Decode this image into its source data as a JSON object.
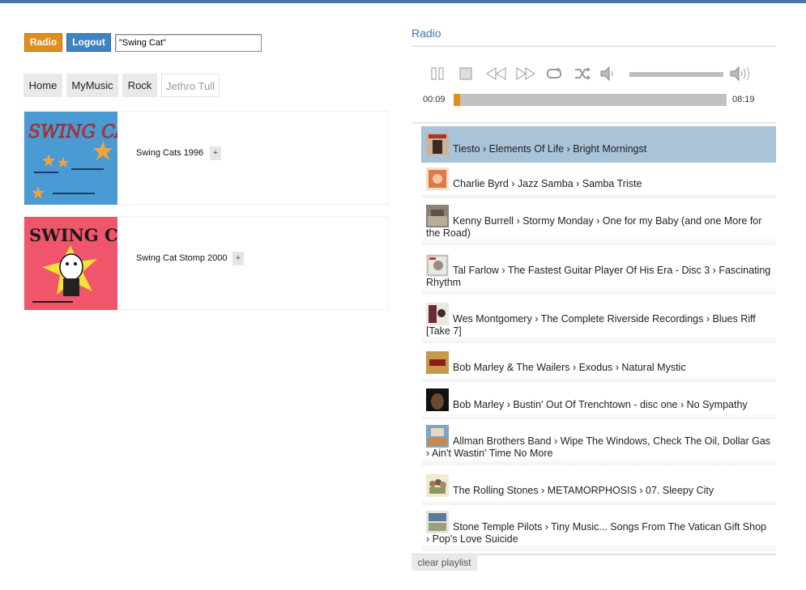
{
  "header": {
    "radio_label": "Radio",
    "logout_label": "Logout"
  },
  "search": {
    "value": "\"Swing Cat\""
  },
  "breadcrumb": [
    "Home",
    "MyMusic",
    "Rock",
    "Jethro Tull"
  ],
  "albums": [
    {
      "title": "Swing Cats 1996",
      "add": "+",
      "cover_text": "SWING CATS"
    },
    {
      "title": "Swing Cat Stomp 2000",
      "add": "+",
      "cover_text": "SWING CATS"
    }
  ],
  "player": {
    "title": "Radio",
    "elapsed": "00:09",
    "duration": "08:19",
    "progress_fraction": 0.02,
    "volume_fraction": 1.0,
    "controls": [
      "pause-icon",
      "stop-icon",
      "rewind-icon",
      "fast-forward-icon",
      "repeat-icon",
      "shuffle-icon",
      "volume-low-icon",
      "volume-high-icon"
    ]
  },
  "playlist": [
    {
      "text": "Tiesto › Elements Of Life › Bright Morningst",
      "selected": true
    },
    {
      "text": "Charlie Byrd › Jazz Samba › Samba Triste"
    },
    {
      "text": "Kenny Burrell › Stormy Monday › One for my Baby (and one More for the Road)"
    },
    {
      "text": "Tal Farlow › The Fastest Guitar Player Of His Era - Disc 3 › Fascinating Rhythm"
    },
    {
      "text": "Wes Montgomery › The Complete Riverside Recordings › Blues Riff [Take 7]"
    },
    {
      "text": "Bob Marley & The Wailers › Exodus › Natural Mystic"
    },
    {
      "text": "Bob Marley › Bustin' Out Of Trenchtown - disc one › No Sympathy"
    },
    {
      "text": "Allman Brothers Band › Wipe The Windows, Check The Oil, Dollar Gas › Ain't Wastin' Time No More"
    },
    {
      "text": "The Rolling Stones › METAMORPHOSIS › 07. Sleepy City"
    },
    {
      "text": "Stone Temple Pilots › Tiny Music... Songs From The Vatican Gift Shop › Pop's Love Suicide"
    }
  ],
  "clear_label": "clear playlist",
  "colors": {
    "accent_orange": "#e0901a",
    "accent_blue": "#3f83c0",
    "selected_row": "#a9c3d8"
  }
}
